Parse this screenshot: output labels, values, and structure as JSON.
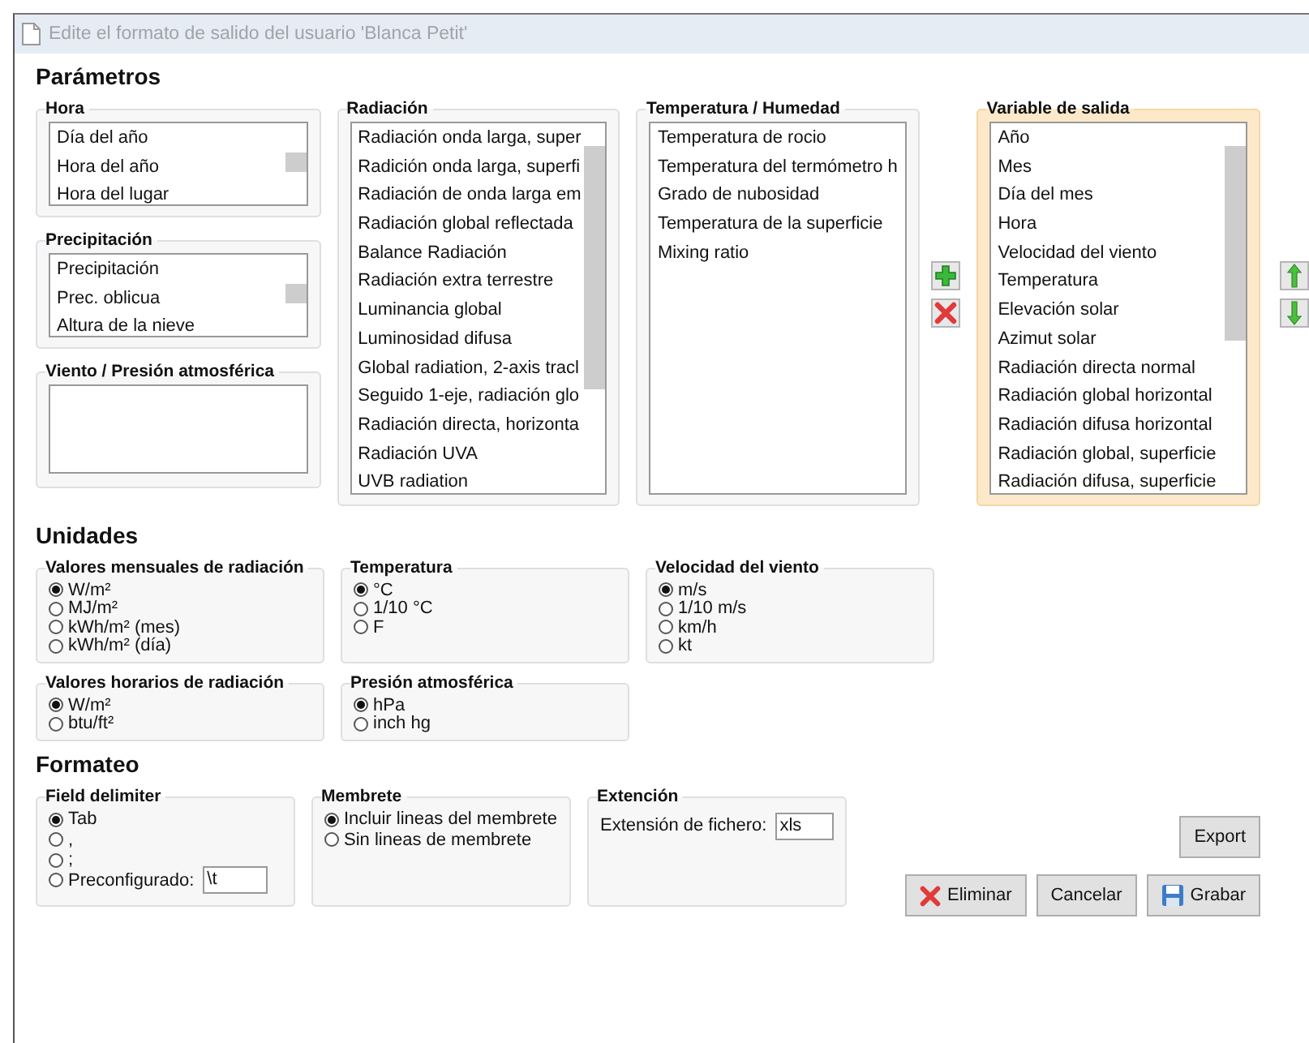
{
  "window": {
    "title": "Edite el formato de salido del usuario 'Blanca Petit'"
  },
  "parametros": {
    "heading": "Parámetros",
    "left_groups": [
      {
        "title": "Hora",
        "items": [
          "Día del año",
          "Hora del año",
          "Hora del lugar"
        ]
      },
      {
        "title": "Precipitación",
        "items": [
          "Precipitación",
          "Prec. oblicua",
          "Altura de la nieve"
        ]
      },
      {
        "title": "Viento / Presión atmosférica"
      }
    ],
    "radiacion": {
      "title": "Radiación",
      "items": [
        "Radiación onda larga, super",
        "Radición onda larga, superfi",
        "Radiación de onda larga em",
        "Radiación global reflectada",
        "Balance Radiación",
        "Radiación extra terrestre",
        "Luminancia global",
        "Luminosidad difusa",
        "Global radiation, 2-axis tracl",
        "Seguido 1-eje, radiación glo",
        "Radiación directa, horizonta",
        "Radiación UVA",
        "UVB radiation"
      ]
    },
    "temperatura_humedad": {
      "title": "Temperatura / Humedad",
      "items": [
        "Temperatura de rocio",
        "Temperatura del termómetro h",
        "Grado de nubosidad",
        "Temperatura de la superficie",
        "Mixing ratio"
      ]
    },
    "variable_salida": {
      "title": "Variable de salida",
      "items": [
        "Año",
        "Mes",
        "Día del mes",
        "Hora",
        "Velocidad del viento",
        "Temperatura",
        "Elevación solar",
        "Azimut solar",
        "Radiación directa normal",
        "Radiación global horizontal",
        "Radiación difusa horizontal",
        "Radiación global, superficie",
        "Radiación difusa, superficie"
      ]
    }
  },
  "unidades": {
    "heading": "Unidades",
    "rows": [
      [
        {
          "title": "Valores mensuales de radiación",
          "options": [
            {
              "label": "W/m²",
              "selected": true
            },
            {
              "label": "MJ/m²",
              "selected": false
            },
            {
              "label": "kWh/m² (mes)",
              "selected": false
            },
            {
              "label": "kWh/m² (día)",
              "selected": false
            }
          ]
        },
        {
          "title": "Temperatura",
          "options": [
            {
              "label": "°C",
              "selected": true
            },
            {
              "label": "1/10 °C",
              "selected": false
            },
            {
              "label": "F",
              "selected": false
            }
          ]
        },
        {
          "title": "Velocidad del viento",
          "options": [
            {
              "label": "m/s",
              "selected": true
            },
            {
              "label": "1/10 m/s",
              "selected": false
            },
            {
              "label": "km/h",
              "selected": false
            },
            {
              "label": "kt",
              "selected": false
            }
          ]
        }
      ],
      [
        {
          "title": "Valores horarios de radiación",
          "options": [
            {
              "label": "W/m²",
              "selected": true
            },
            {
              "label": "btu/ft²",
              "selected": false
            }
          ]
        },
        {
          "title": "Presión atmosférica",
          "options": [
            {
              "label": "hPa",
              "selected": true
            },
            {
              "label": "inch hg",
              "selected": false
            }
          ]
        }
      ]
    ]
  },
  "formateo": {
    "heading": "Formateo",
    "field_delimiter": {
      "title": "Field delimiter",
      "options": [
        {
          "label": "Tab",
          "selected": true
        },
        {
          "label": ",",
          "selected": false
        },
        {
          "label": ";",
          "selected": false
        },
        {
          "label": "Preconfigurado:",
          "selected": false,
          "value": "\\t"
        }
      ]
    },
    "membrete": {
      "title": "Membrete",
      "options": [
        {
          "label": "Incluir lineas del membrete",
          "selected": true
        },
        {
          "label": "Sin lineas de membrete",
          "selected": false
        }
      ]
    },
    "extension": {
      "title": "Extención",
      "label": "Extensión de fichero:",
      "value": "xls"
    }
  },
  "buttons": {
    "export": "Export",
    "eliminar": "Eliminar",
    "cancelar": "Cancelar",
    "grabar": "Grabar"
  }
}
